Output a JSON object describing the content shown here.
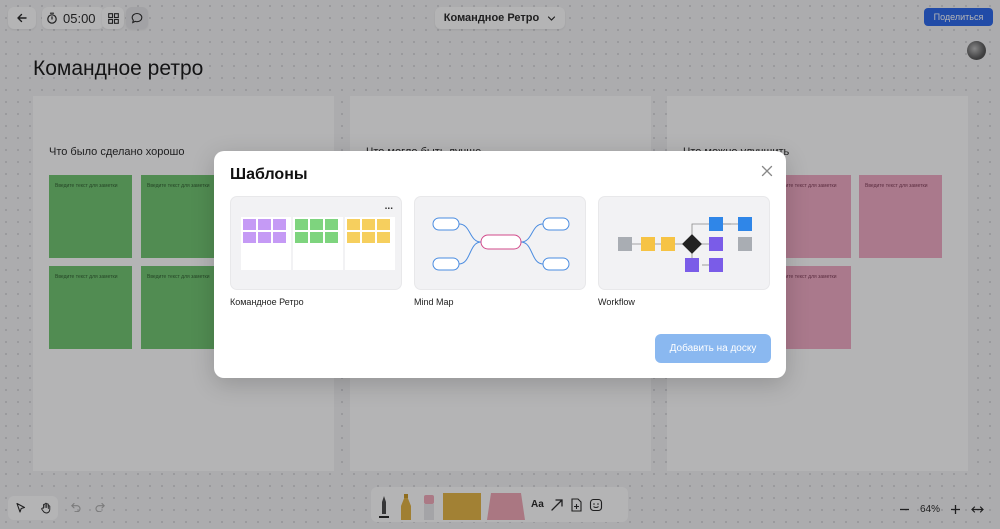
{
  "topbar": {
    "timer": "05:00",
    "board_name": "Командное Ретро",
    "share_label": "Поделиться"
  },
  "board": {
    "title": "Командное ретро",
    "columns": [
      {
        "heading": "Что было сделано хорошо",
        "notes": [
          "Введите текст для заметки",
          "Введите текст для заметки",
          "Введите текст для заметки",
          "Введите текст для заметки"
        ]
      },
      {
        "heading": "Что могло быть лучше",
        "notes": []
      },
      {
        "heading": "Что можно улучшить",
        "notes": [
          "Введите текст для заметки",
          "Введите текст для заметки",
          "Введите текст для заметки"
        ]
      }
    ],
    "note_colors": {
      "good": "#6cc46c",
      "improve": "#f0a8c2"
    }
  },
  "modal": {
    "title": "Шаблоны",
    "templates": [
      {
        "label": "Командное Ретро",
        "more": "..."
      },
      {
        "label": "Mind Map"
      },
      {
        "label": "Workflow"
      }
    ],
    "add_button": "Добавить на доску"
  },
  "toolbar": {
    "text_tool": "Aa",
    "zoom": "64%"
  },
  "colors": {
    "accent": "#2563eb",
    "add_button": "#8ab8f0"
  }
}
